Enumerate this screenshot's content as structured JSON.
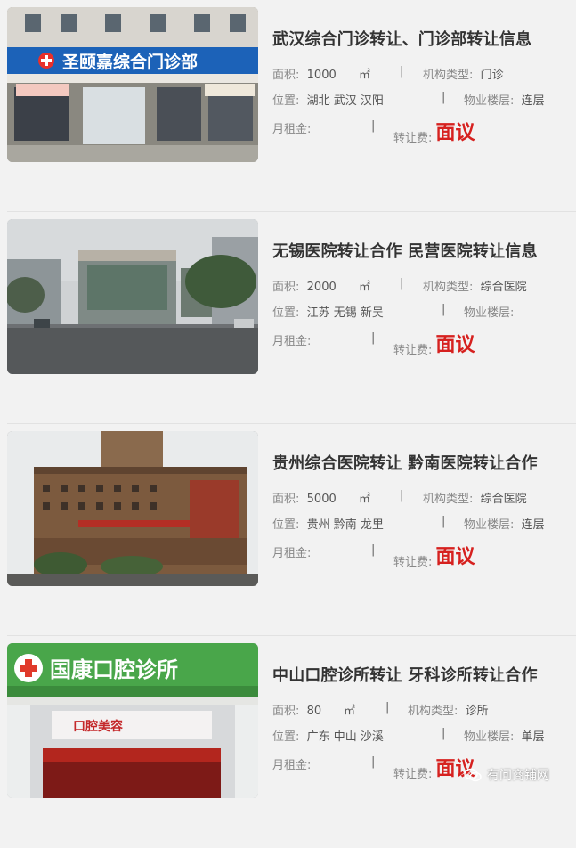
{
  "labels": {
    "area": "面积:",
    "area_unit": "㎡",
    "type": "机构类型:",
    "location": "位置:",
    "floor": "物业楼层:",
    "rent": "月租金:",
    "fee": "转让费:",
    "separator": "|"
  },
  "listings": [
    {
      "title": "武汉综合门诊转让、门诊部转让信息",
      "area": "1000",
      "type": "门诊",
      "location": "湖北 武汉 汉阳",
      "floor": "连层",
      "rent": "",
      "fee": "面议",
      "photo_sign": "圣颐嘉综合门诊部"
    },
    {
      "title": "无锡医院转让合作 民营医院转让信息",
      "area": "2000",
      "type": "综合医院",
      "location": "江苏 无锡 新吴",
      "floor": "",
      "rent": "",
      "fee": "面议",
      "photo_sign": ""
    },
    {
      "title": "贵州综合医院转让 黔南医院转让合作",
      "area": "5000",
      "type": "综合医院",
      "location": "贵州 黔南 龙里",
      "floor": "连层",
      "rent": "",
      "fee": "面议",
      "photo_sign": ""
    },
    {
      "title": "中山口腔诊所转让 牙科诊所转让合作",
      "area": "80",
      "type": "诊所",
      "location": "广东 中山 沙溪",
      "floor": "单层",
      "rent": "",
      "fee": "面议",
      "photo_sign": "国康口腔诊所",
      "photo_sign_sub": "口腔美容"
    }
  ],
  "watermark": {
    "text": "有问商铺网",
    "icon": "wechat-icon"
  },
  "colors": {
    "background": "#f2f2f2",
    "price_red": "#d6211f",
    "title": "#333333"
  }
}
